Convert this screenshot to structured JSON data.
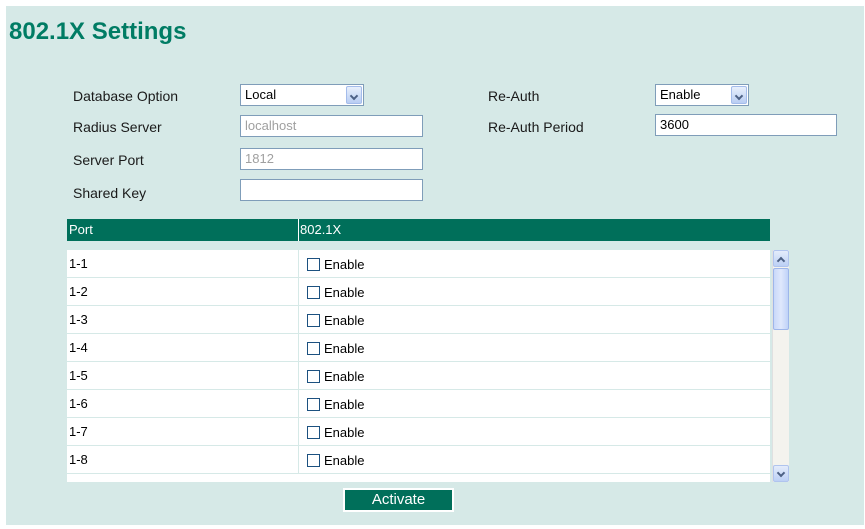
{
  "page": {
    "title": "802.1X Settings"
  },
  "form": {
    "database_option": {
      "label": "Database Option",
      "value": "Local"
    },
    "radius_server": {
      "label": "Radius Server",
      "value": "localhost"
    },
    "server_port": {
      "label": "Server Port",
      "value": "1812"
    },
    "shared_key": {
      "label": "Shared Key",
      "value": ""
    },
    "re_auth": {
      "label": "Re-Auth",
      "value": "Enable"
    },
    "re_auth_period": {
      "label": "Re-Auth Period",
      "value": "3600"
    }
  },
  "table": {
    "headers": {
      "port": "Port",
      "dot1x": "802.1X"
    },
    "rows": [
      {
        "port": "1-1",
        "enable_label": "Enable",
        "checked": false
      },
      {
        "port": "1-2",
        "enable_label": "Enable",
        "checked": false
      },
      {
        "port": "1-3",
        "enable_label": "Enable",
        "checked": false
      },
      {
        "port": "1-4",
        "enable_label": "Enable",
        "checked": false
      },
      {
        "port": "1-5",
        "enable_label": "Enable",
        "checked": false
      },
      {
        "port": "1-6",
        "enable_label": "Enable",
        "checked": false
      },
      {
        "port": "1-7",
        "enable_label": "Enable",
        "checked": false
      },
      {
        "port": "1-8",
        "enable_label": "Enable",
        "checked": false
      }
    ]
  },
  "actions": {
    "activate_label": "Activate"
  },
  "colors": {
    "accent": "#006f5a",
    "title": "#007c64",
    "background": "#d6e9e7"
  },
  "icons": {
    "select_arrow": "chevron-down-icon",
    "scroll_up": "chevron-up-icon",
    "scroll_down": "chevron-down-icon"
  }
}
